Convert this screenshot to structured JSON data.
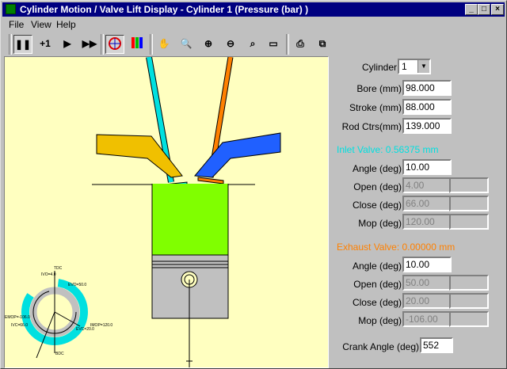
{
  "window": {
    "title": "Cylinder Motion / Valve Lift Display - Cylinder 1 (Pressure (bar) )"
  },
  "menu": [
    "File",
    "View",
    "Help"
  ],
  "toolbar": {
    "step_label": "+1"
  },
  "diagram": {
    "tdc": "TDC",
    "bdc": "BDC",
    "ivo": "IVO=4.0",
    "evo": "EVO=50.0",
    "ivc": "IVC=66.0",
    "evc": "EVC=20.0",
    "imop": "IMOP=120.0",
    "emop": "EMOP=-106.0"
  },
  "panel": {
    "cylinder_label": "Cylinder",
    "cylinder_value": "1",
    "bore_label": "Bore (mm)",
    "bore_value": "98.000",
    "stroke_label": "Stroke (mm)",
    "stroke_value": "88.000",
    "rod_label": "Rod Ctrs(mm)",
    "rod_value": "139.000",
    "inlet_title": "Inlet Valve: 0.56375 mm",
    "exhaust_title": "Exhaust Valve: 0.00000 mm",
    "angle_label": "Angle (deg)",
    "open_label": "Open (deg)",
    "close_label": "Close (deg)",
    "mop_label": "Mop (deg)",
    "inlet_angle": "10.00",
    "inlet_open": "4.00",
    "inlet_close": "66.00",
    "inlet_mop": "120.00",
    "exhaust_angle": "10.00",
    "exhaust_open": "50.00",
    "exhaust_close": "20.00",
    "exhaust_mop": "-106.00",
    "crank_label": "Crank Angle (deg)",
    "crank_value": "552"
  },
  "colors": {
    "inlet": "#00e0e0",
    "exhaust": "#ff8000",
    "cylinder": "#80ff00",
    "background": "#ffffc0",
    "inlet_port": "#f0c000",
    "exhaust_port": "#2060ff"
  }
}
